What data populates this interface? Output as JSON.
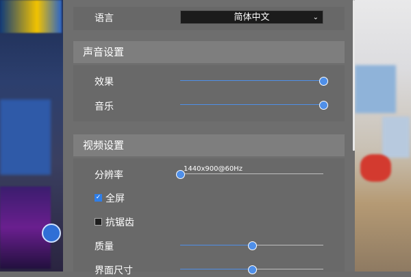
{
  "language": {
    "label": "语言",
    "value": "简体中文"
  },
  "audio": {
    "title": "声音设置",
    "effects": {
      "label": "效果",
      "value": 1.0
    },
    "music": {
      "label": "音乐",
      "value": 1.0
    }
  },
  "video": {
    "title": "视频设置",
    "resolution": {
      "label": "分辨率",
      "value_text": "1440x900@60Hz",
      "value": 0.0
    },
    "fullscreen": {
      "label": "全屏",
      "checked": true
    },
    "antialias": {
      "label": "抗锯齿",
      "checked": false
    },
    "quality": {
      "label": "质量",
      "value": 0.5
    },
    "ui_scale": {
      "label": "界面尺寸",
      "value": 0.5
    }
  },
  "colors": {
    "accent": "#4f8fe8"
  }
}
